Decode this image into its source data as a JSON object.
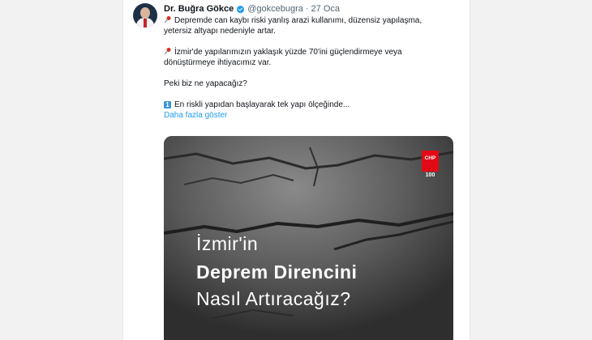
{
  "tweet": {
    "author_name": "Dr. Buğra Gökce",
    "handle": "@gokcebugra",
    "separator": "·",
    "date": "27 Oca",
    "lines": [
      "Depremde can kaybı riski yanlış arazi kullanımı, düzensiz yapılaşma,",
      "yetersiz altyapı nedeniyle artar.",
      "İzmir'de yapılarımızın yaklaşık yüzde 70'ini güçlendirmeye veya",
      "dönüştürmeye ihtiyacımız var.",
      "Peki biz ne yapacağız?",
      "En riskli yapıdan başlayarak tek yapı ölçeğinde..."
    ],
    "badge_number": "1",
    "show_more": "Daha fazla göster"
  },
  "media": {
    "logo_text": "CHP",
    "logo_number": "100",
    "headline_1": "İzmir'in",
    "headline_2": "Deprem Direncini",
    "headline_3": "Nasıl Artıracağız?"
  },
  "colors": {
    "link": "#1d9bf0",
    "verified": "#1d9bf0",
    "pin": "#d93025",
    "badge": "#3b94d9",
    "logo_red": "#e30a17"
  },
  "icons": [
    "avatar",
    "verified-icon",
    "pin-icon",
    "number-badge-icon",
    "chp-logo"
  ]
}
